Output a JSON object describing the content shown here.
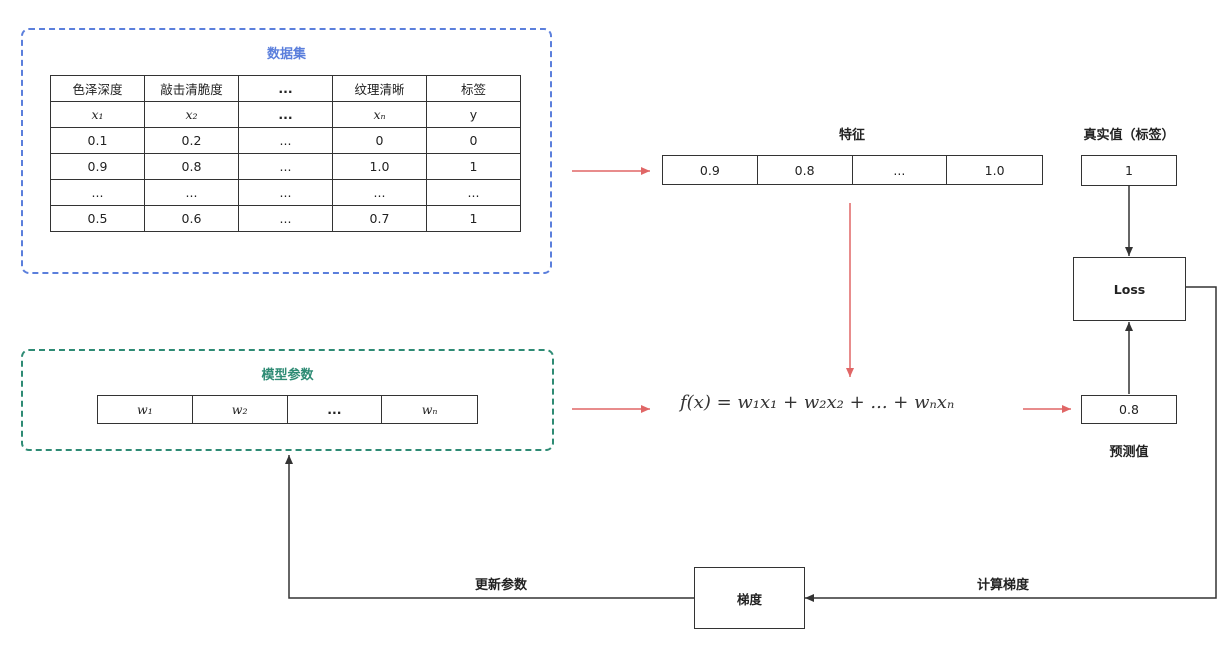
{
  "dataset": {
    "title": "数据集",
    "headers": [
      "色泽深度",
      "敲击清脆度",
      "...",
      "纹理清晰",
      "标签"
    ],
    "symbols": [
      "x₁",
      "x₂",
      "...",
      "xₙ",
      "y"
    ],
    "rows": [
      [
        "0.1",
        "0.2",
        "...",
        "0",
        "0"
      ],
      [
        "0.9",
        "0.8",
        "...",
        "1.0",
        "1"
      ],
      [
        "...",
        "...",
        "...",
        "...",
        "..."
      ],
      [
        "0.5",
        "0.6",
        "...",
        "0.7",
        "1"
      ]
    ]
  },
  "features": {
    "title": "特征",
    "values": [
      "0.9",
      "0.8",
      "...",
      "1.0"
    ]
  },
  "true_value": {
    "title": "真实值（标签）",
    "value": "1"
  },
  "loss": {
    "label": "Loss"
  },
  "model_params": {
    "title": "模型参数",
    "values": [
      "w₁",
      "w₂",
      "...",
      "wₙ"
    ]
  },
  "formula": "f(x) = w₁x₁ + w₂x₂ + ... + wₙxₙ",
  "prediction": {
    "value": "0.8",
    "title": "预测值"
  },
  "gradient": {
    "label": "梯度"
  },
  "edges": {
    "update_params": "更新参数",
    "compute_gradient": "计算梯度"
  },
  "colors": {
    "dataset_border": "#5b7fdc",
    "params_border": "#2e8b74",
    "flow_arrow": "#e06666",
    "feedback_arrow": "#333333"
  }
}
